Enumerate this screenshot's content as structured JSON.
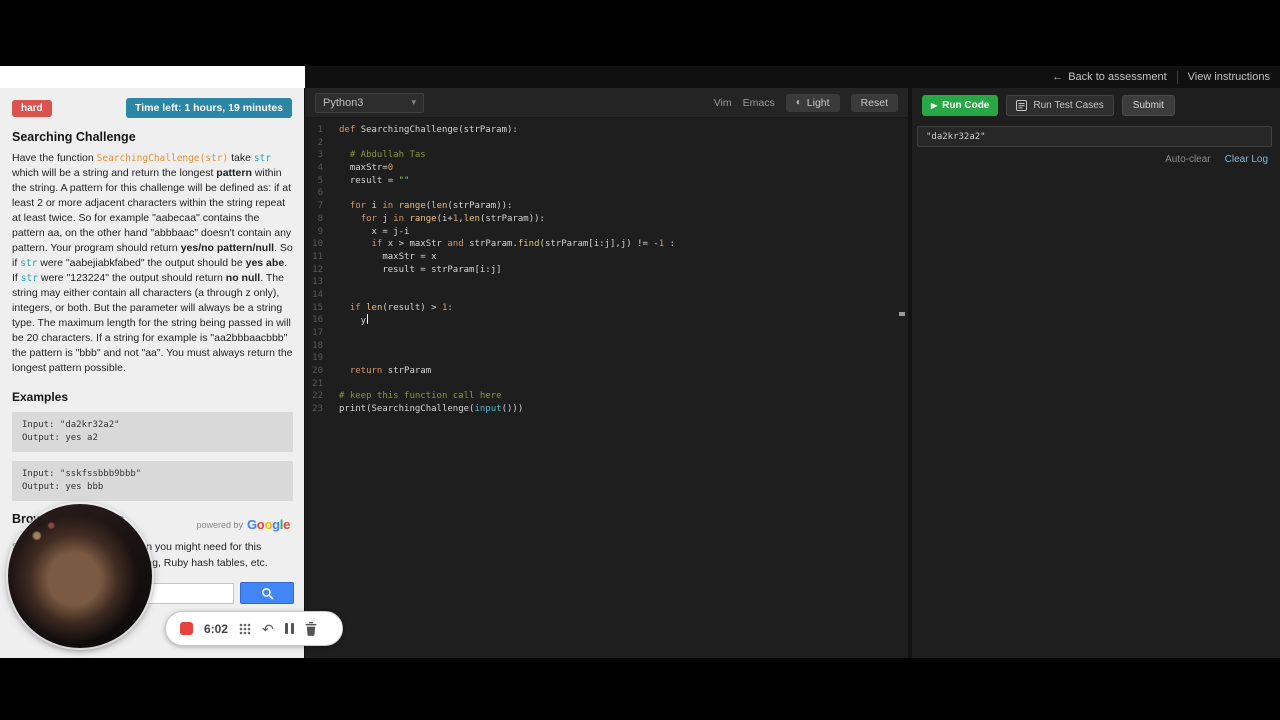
{
  "header": {
    "back_label": "Back to assessment",
    "view_instructions": "View instructions"
  },
  "icons": {
    "back_arrow": "←",
    "caret_down": "▾",
    "theme_toggle": "◐",
    "play": "▶",
    "undo": "↶",
    "search": "magnifier",
    "grid": "grid-dots",
    "pause": "pause-bars",
    "trash": "trash-can",
    "stop": "stop-square"
  },
  "colors": {
    "difficulty_badge": "#d9534f",
    "time_badge": "#2b87a5",
    "run_button": "#28a745",
    "search_button": "#4285f4",
    "record_red": "#e8423d"
  },
  "sidebar": {
    "difficulty": "hard",
    "time_left": "Time left: 1 hours, 19 minutes",
    "title": "Searching Challenge",
    "description_segments": [
      {
        "t": "Have the function "
      },
      {
        "t": "SearchingChallenge(str)",
        "c": "o"
      },
      {
        "t": " take "
      },
      {
        "t": "str",
        "c": "t"
      },
      {
        "t": " which will be a string and return the longest "
      },
      {
        "t": "pattern",
        "c": "b"
      },
      {
        "t": " within the string. A pattern for this challenge will be defined as: if at least 2 or more adjacent characters within the string repeat at least twice. So for example \"aabecaa\" contains the pattern aa, on the other hand \"abbbaac\" doesn't contain any pattern. Your program should return "
      },
      {
        "t": "yes/no pattern/null",
        "c": "b"
      },
      {
        "t": ". So if "
      },
      {
        "t": "str",
        "c": "t"
      },
      {
        "t": " were \"aabejiabkfabed\" the output should be "
      },
      {
        "t": "yes abe",
        "c": "b"
      },
      {
        "t": ". If "
      },
      {
        "t": "str",
        "c": "t"
      },
      {
        "t": " were \"123224\" the output should return "
      },
      {
        "t": "no null",
        "c": "b"
      },
      {
        "t": ". The string may either contain all characters (a through z only), integers, or both. But the parameter will always be a string type. The maximum length for the string being passed in will be 20 characters. If a string for example is \"aa2bbbaacbbb\" the pattern is \"bbb\" and not \"aa\". You must always return the longest pattern possible."
      }
    ],
    "examples_title": "Examples",
    "examples": [
      {
        "input": "Input: \"da2kr32a2\"",
        "output": "Output: yes a2"
      },
      {
        "input": "Input: \"sskfssbbb9bbb\"",
        "output": "Output: yes bbb"
      }
    ],
    "resources": {
      "title": "Browse Resources",
      "powered_by": "powered by",
      "google_letters": [
        "G",
        "o",
        "o",
        "g",
        "l",
        "e"
      ],
      "google_colors": [
        "#4285F4",
        "#EA4335",
        "#FBBC05",
        "#4285F4",
        "#34A853",
        "#EA4335"
      ],
      "hint_line1": "Search for any documentation you might need for this",
      "hint_line2": "challenge, e.g. Python indexing, Ruby hash tables, etc.",
      "search_value": ""
    }
  },
  "recorder": {
    "time": "6:02"
  },
  "editor": {
    "language": "Python3",
    "toolbar": {
      "vim": "Vim",
      "emacs": "Emacs",
      "light": "Light",
      "reset": "Reset"
    },
    "lines": [
      {
        "n": 1,
        "s": [
          {
            "t": "def ",
            "c": "k"
          },
          {
            "t": "SearchingChallenge(strParam):"
          }
        ]
      },
      {
        "n": 2,
        "s": []
      },
      {
        "n": 3,
        "s": [
          {
            "t": "  # Abdullah Tas",
            "c": "c"
          }
        ]
      },
      {
        "n": 4,
        "s": [
          {
            "t": "  maxStr="
          },
          {
            "t": "0",
            "c": "n"
          }
        ]
      },
      {
        "n": 5,
        "s": [
          {
            "t": "  result = "
          },
          {
            "t": "\"\"",
            "c": "s"
          }
        ]
      },
      {
        "n": 6,
        "s": []
      },
      {
        "n": 7,
        "s": [
          {
            "t": "  "
          },
          {
            "t": "for",
            "c": "k"
          },
          {
            "t": " i "
          },
          {
            "t": "in",
            "c": "k"
          },
          {
            "t": " "
          },
          {
            "t": "range",
            "c": "b"
          },
          {
            "t": "("
          },
          {
            "t": "len",
            "c": "b"
          },
          {
            "t": "(strParam)):"
          }
        ]
      },
      {
        "n": 8,
        "s": [
          {
            "t": "    "
          },
          {
            "t": "for",
            "c": "k"
          },
          {
            "t": " j "
          },
          {
            "t": "in",
            "c": "k"
          },
          {
            "t": " "
          },
          {
            "t": "range",
            "c": "b"
          },
          {
            "t": "(i+"
          },
          {
            "t": "1",
            "c": "n"
          },
          {
            "t": ","
          },
          {
            "t": "len",
            "c": "b"
          },
          {
            "t": "(strParam)):"
          }
        ]
      },
      {
        "n": 9,
        "s": [
          {
            "t": "      x = j-i"
          }
        ]
      },
      {
        "n": 10,
        "s": [
          {
            "t": "      "
          },
          {
            "t": "if",
            "c": "k"
          },
          {
            "t": " x > maxStr "
          },
          {
            "t": "and",
            "c": "k"
          },
          {
            "t": " strParam."
          },
          {
            "t": "find",
            "c": "b"
          },
          {
            "t": "(strParam[i:j],j) != -"
          },
          {
            "t": "1",
            "c": "n"
          },
          {
            "t": " :"
          }
        ]
      },
      {
        "n": 11,
        "s": [
          {
            "t": "        maxStr = x"
          }
        ]
      },
      {
        "n": 12,
        "s": [
          {
            "t": "        result = strParam[i:j]"
          }
        ]
      },
      {
        "n": 13,
        "s": []
      },
      {
        "n": 14,
        "s": []
      },
      {
        "n": 15,
        "s": [
          {
            "t": "  "
          },
          {
            "t": "if",
            "c": "k"
          },
          {
            "t": " "
          },
          {
            "t": "len",
            "c": "b"
          },
          {
            "t": "(result) > "
          },
          {
            "t": "1",
            "c": "n"
          },
          {
            "t": ":"
          }
        ]
      },
      {
        "n": 16,
        "cursor": true,
        "s": [
          {
            "t": "    y"
          }
        ]
      },
      {
        "n": 17,
        "s": []
      },
      {
        "n": 18,
        "s": []
      },
      {
        "n": 19,
        "s": []
      },
      {
        "n": 20,
        "s": [
          {
            "t": "  "
          },
          {
            "t": "return",
            "c": "k"
          },
          {
            "t": " strParam"
          }
        ]
      },
      {
        "n": 21,
        "s": []
      },
      {
        "n": 22,
        "s": [
          {
            "t": "# keep this function call here",
            "c": "c"
          }
        ]
      },
      {
        "n": 23,
        "s": [
          {
            "t": "print(SearchingChallenge("
          },
          {
            "t": "input",
            "c": "t"
          },
          {
            "t": "()))"
          }
        ]
      }
    ]
  },
  "console": {
    "run_code": "Run Code",
    "run_tests": "Run Test Cases",
    "submit": "Submit",
    "output": "\"da2kr32a2\"",
    "auto_clear": "Auto-clear",
    "clear_log": "Clear Log"
  }
}
